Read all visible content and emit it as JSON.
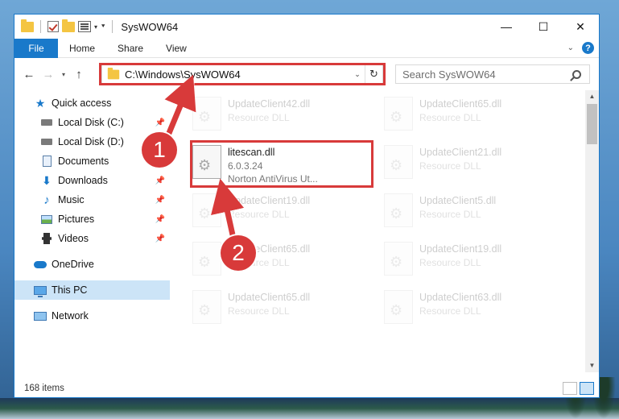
{
  "window": {
    "title": "SysWOW64",
    "minimize": "—",
    "maximize": "☐",
    "close": "✕"
  },
  "ribbon": {
    "tabs": [
      "File",
      "Home",
      "Share",
      "View"
    ]
  },
  "address": {
    "path": "C:\\Windows\\SysWOW64",
    "search_placeholder": "Search SysWOW64"
  },
  "nav": {
    "items": [
      {
        "label": "Quick access",
        "icon": "star-icon"
      },
      {
        "label": "Local Disk (C:)",
        "icon": "drive-icon",
        "pinned": true
      },
      {
        "label": "Local Disk (D:)",
        "icon": "drive-icon",
        "pinned": true
      },
      {
        "label": "Documents",
        "icon": "documents-icon",
        "pinned": true
      },
      {
        "label": "Downloads",
        "icon": "downloads-icon",
        "pinned": true
      },
      {
        "label": "Music",
        "icon": "music-icon",
        "pinned": true
      },
      {
        "label": "Pictures",
        "icon": "pictures-icon",
        "pinned": true
      },
      {
        "label": "Videos",
        "icon": "videos-icon",
        "pinned": true
      },
      {
        "label": "OneDrive",
        "icon": "onedrive-icon"
      },
      {
        "label": "This PC",
        "icon": "this-pc-icon",
        "selected": true
      },
      {
        "label": "Network",
        "icon": "network-icon"
      }
    ]
  },
  "files": [
    {
      "name": "UpdateClient42.dll",
      "type": "Resource DLL"
    },
    {
      "name": "UpdateClient65.dll",
      "type": "Resource DLL"
    },
    {
      "name": "litescan.dll",
      "version": "6.0.3.24",
      "company": "Norton AntiVirus Ut..."
    },
    {
      "name": "UpdateClient21.dll",
      "type": "Resource DLL"
    },
    {
      "name": "UpdateClient19.dll",
      "type": "Resource DLL"
    },
    {
      "name": "UpdateClient5.dll",
      "type": "Resource DLL"
    },
    {
      "name": "UpdateClient65.dll",
      "type": "Resource DLL"
    },
    {
      "name": "UpdateClient19.dll",
      "type": "Resource DLL"
    },
    {
      "name": "UpdateClient65.dll",
      "type": "Resource DLL"
    },
    {
      "name": "UpdateClient63.dll",
      "type": "Resource DLL"
    }
  ],
  "status": {
    "count": "168 items"
  },
  "annotations": {
    "step1": "1",
    "step2": "2",
    "color": "#d83a3a"
  }
}
